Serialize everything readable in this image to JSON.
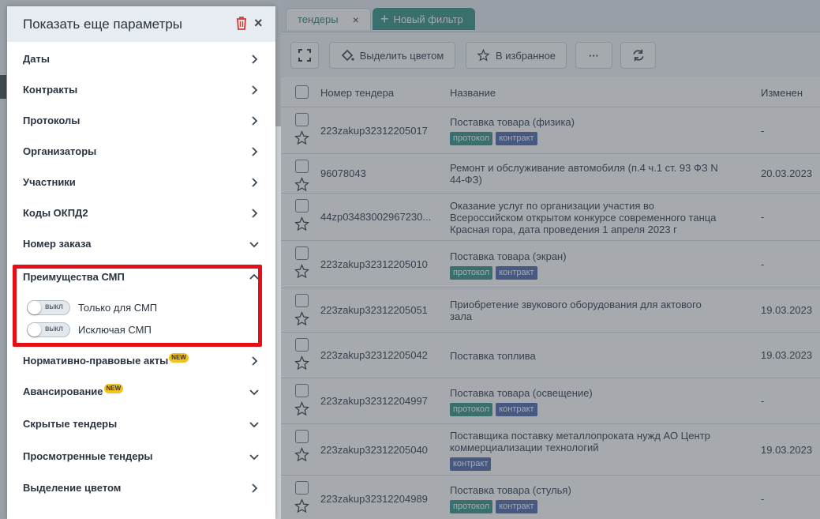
{
  "tabs": {
    "active_label": "тендеры",
    "active_close": "×",
    "new_filter_label": "Новый фильтр"
  },
  "toolbar": {
    "highlight_label": "Выделить цветом",
    "favorite_label": "В избранное",
    "more_label": "···"
  },
  "table": {
    "headers": {
      "number": "Номер тендера",
      "name": "Название",
      "changed": "Изменен"
    },
    "rows": [
      {
        "number": "223zakup32312205017",
        "name": [
          "Поставка товара (физика)"
        ],
        "tags": [
          "протокол",
          "контракт"
        ],
        "changed": "-"
      },
      {
        "number": "96078043",
        "name": [
          "Ремонт и обслуживание автомобиля (п.4 ч.1 ст. 93 ФЗ N",
          "44-ФЗ)"
        ],
        "tags": [],
        "changed": "20.03.2023"
      },
      {
        "number": "44zp03483002967230...",
        "name": [
          "Оказание услуг по организации участия во",
          "Всероссийском открытом конкурсе современного танца",
          "Красная гора, дата проведения 1 апреля 2023 г"
        ],
        "tags": [],
        "changed": "-"
      },
      {
        "number": "223zakup32312205010",
        "name": [
          "Поставка товара (экран)"
        ],
        "tags": [
          "протокол",
          "контракт"
        ],
        "changed": "-"
      },
      {
        "number": "223zakup32312205051",
        "name": [
          "Приобретение звукового оборудования для актового",
          "зала"
        ],
        "tags": [],
        "changed": "19.03.2023"
      },
      {
        "number": "223zakup32312205042",
        "name": [
          "Поставка топлива"
        ],
        "tags": [],
        "changed": "19.03.2023"
      },
      {
        "number": "223zakup32312204997",
        "name": [
          "Поставка товара (освещение)"
        ],
        "tags": [
          "протокол",
          "контракт"
        ],
        "changed": "-"
      },
      {
        "number": "223zakup32312205040",
        "name": [
          "Поставщика поставку металлопроката нужд АО Центр",
          "коммерциализации технологий"
        ],
        "tags": [
          "контракт"
        ],
        "changed": "19.03.2023"
      },
      {
        "number": "223zakup32312204989",
        "name": [
          "Поставка товара (стулья)"
        ],
        "tags": [
          "протокол",
          "контракт"
        ],
        "changed": "-"
      }
    ]
  },
  "panel": {
    "title": "Показать еще параметры",
    "close": "×",
    "items": {
      "dates": "Даты",
      "contracts": "Контракты",
      "protocols": "Протоколы",
      "organizers": "Организаторы",
      "participants": "Участники",
      "okpd2": "Коды ОКПД2",
      "order_number": "Номер заказа",
      "smp": "Преимущества СМП",
      "legal_acts": "Нормативно-правовые акты",
      "advance": "Авансирование",
      "hidden": "Скрытые тендеры",
      "viewed": "Просмотренные тендеры",
      "color": "Выделение цветом"
    },
    "new_badge": "NEW",
    "smp_options": {
      "only_smp": "Только для СМП",
      "exclude_smp": "Исключая СМП",
      "toggle_off": "выкл"
    }
  },
  "colors": {
    "accent": "#2f8f81",
    "tag_contract": "#4a63a8",
    "highlight_frame": "#e40f16",
    "badge": "#f4c21a"
  }
}
